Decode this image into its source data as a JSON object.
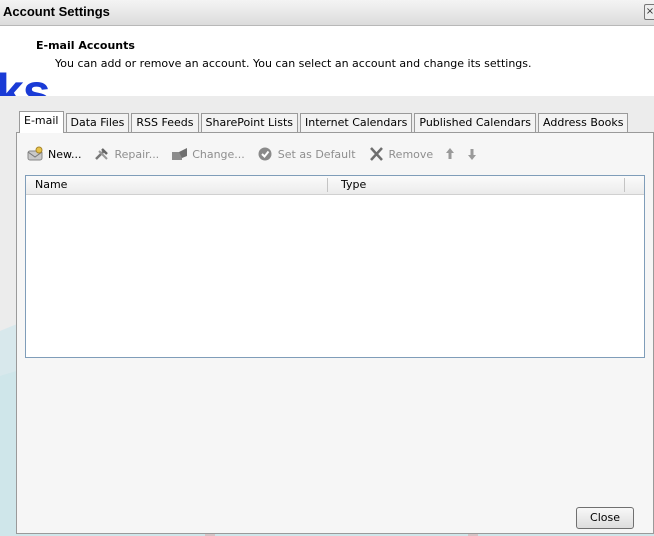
{
  "window": {
    "title": "Account Settings",
    "close_glyph": "×"
  },
  "header": {
    "title": "E-mail Accounts",
    "description": "You can add or remove an account. You can select an account and change its settings.",
    "watermark": "ks"
  },
  "tabs": [
    {
      "label": "E-mail",
      "active": true
    },
    {
      "label": "Data Files",
      "active": false
    },
    {
      "label": "RSS Feeds",
      "active": false
    },
    {
      "label": "SharePoint Lists",
      "active": false
    },
    {
      "label": "Internet Calendars",
      "active": false
    },
    {
      "label": "Published Calendars",
      "active": false
    },
    {
      "label": "Address Books",
      "active": false
    }
  ],
  "toolbar": {
    "new": {
      "label": "New...",
      "icon": "new-account-icon",
      "enabled": true
    },
    "repair": {
      "label": "Repair...",
      "icon": "wrench-hammer-icon",
      "enabled": false
    },
    "change": {
      "label": "Change...",
      "icon": "change-icon",
      "enabled": false
    },
    "set_default": {
      "label": "Set as Default",
      "icon": "checkmark-circle-icon",
      "enabled": false
    },
    "remove": {
      "label": "Remove",
      "icon": "x-icon",
      "enabled": false
    },
    "move_up": {
      "icon": "arrow-up-icon",
      "enabled": false
    },
    "move_down": {
      "icon": "arrow-down-icon",
      "enabled": false
    }
  },
  "account_list": {
    "columns": [
      "Name",
      "Type"
    ],
    "rows": []
  },
  "footer": {
    "close_label": "Close"
  },
  "colors": {
    "watermark": "#1a3bd6",
    "panel": "#ececec",
    "swirl": "#c8e6ec"
  }
}
